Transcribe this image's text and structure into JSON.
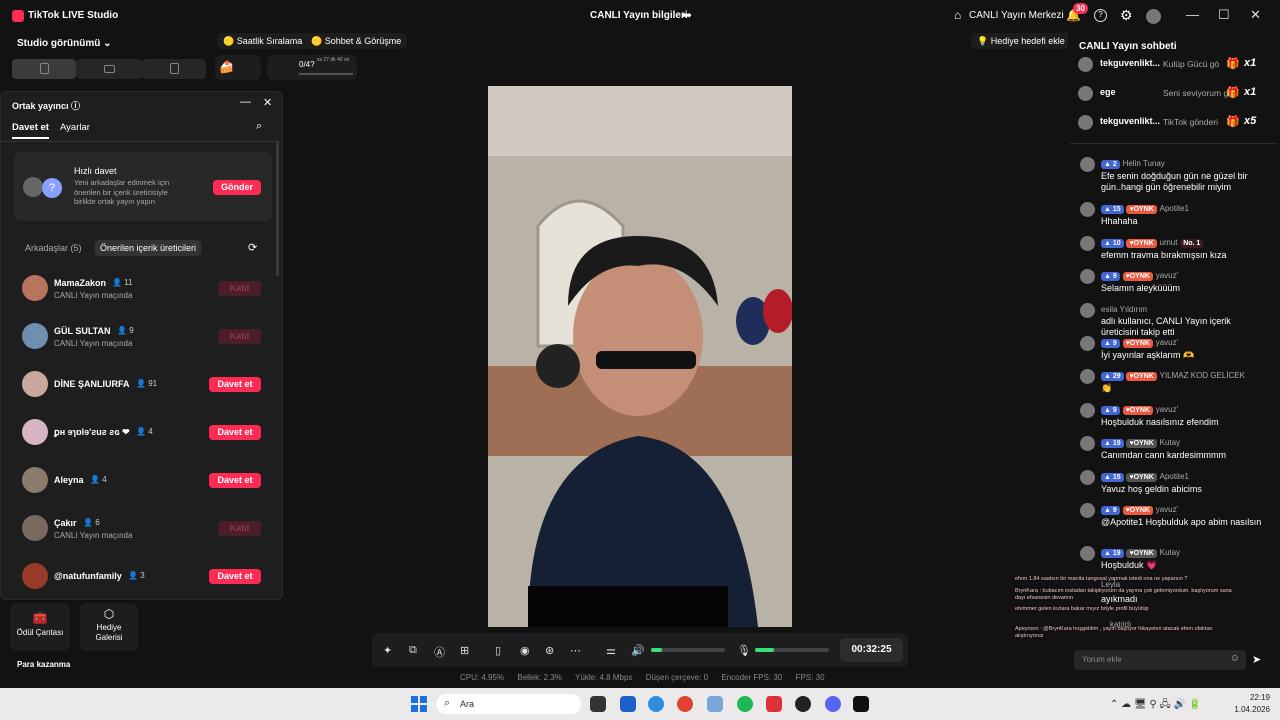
{
  "titlebar": {
    "app": "TikTok LIVE Studio",
    "center": "CANLI Yayın bilgileri",
    "home": "CANLI Yayın Merkezi",
    "badge": "30"
  },
  "studio": {
    "title": "Studio görünümü",
    "bottom": {
      "gift_bag": "Ödül Çantası",
      "gallery": "Hediye Galerisi",
      "earn": "Para kazanma"
    }
  },
  "topbar": {
    "hourly": "Saatlik Sıralama",
    "chat_match": "Sohbet & Görüşme",
    "gift_goal": "Hediye hedefi ekle",
    "progress": "0/4?",
    "timer": "ss 27 dk 40 sn"
  },
  "popup": {
    "title": "Ortak yayıncı",
    "tab_invite": "Davet et",
    "tab_settings": "Ayarlar",
    "quick": {
      "title": "Hızlı davet",
      "desc": "Yeni arkadaşlar edinmek için önerilen bir içerik üreticisiyle birlikte ortak yayın yapın",
      "button": "Gönder"
    },
    "friends": "Arkadaşlar (5)",
    "suggested": "Önerilen içerik üreticileri",
    "rows": [
      {
        "name": "MamaZakon",
        "count": "11",
        "sub": "CANLI Yayın maçında",
        "btn": "Katıl",
        "active": false,
        "color": "#b8745c"
      },
      {
        "name": "GÜL SULTAN",
        "count": "9",
        "sub": "CANLI Yayın maçında",
        "btn": "Katıl",
        "active": false,
        "color": "#6f8fb0"
      },
      {
        "name": "DİNE ŞANLIURFA",
        "count": "91",
        "sub": "",
        "btn": "Davet et",
        "active": true,
        "color": "#c9a89b"
      },
      {
        "name": "ꝑʜ ɘɿɒlɘ'ƨuƨ ƨɢ ❤",
        "count": "4",
        "sub": "",
        "btn": "Davet et",
        "active": true,
        "color": "#d9b4c4"
      },
      {
        "name": "Aleyna",
        "count": "4",
        "sub": "",
        "btn": "Davet et",
        "active": true,
        "color": "#8b7b6a"
      },
      {
        "name": "Çakır",
        "count": "6",
        "sub": "CANLI Yayın maçında",
        "btn": "Katıl",
        "active": false,
        "color": "#7a6a5e"
      },
      {
        "name": "@natufunfamily",
        "count": "3",
        "sub": "",
        "btn": "Davet et",
        "active": true,
        "color": "#9a3a2a"
      }
    ]
  },
  "chat": {
    "title": "CANLI Yayın sohbeti",
    "placeholder": "Yorum ekle",
    "gifts": [
      {
        "name": "tekguvenlikt...",
        "msg": "Kulüp Gücü gö",
        "mult": "x1"
      },
      {
        "name": "ege",
        "msg": "Seni seviyorum gönderildi",
        "mult": "x1"
      },
      {
        "name": "tekguvenlikt...",
        "msg": "TikTok gönderi",
        "mult": "x5"
      }
    ],
    "messages": [
      {
        "lvl": "2",
        "tag": "",
        "tag2": "",
        "user": "Helin Tunay",
        "msg": "Efe senin doğduğun gün ne güzel bir gün..hangi gün öğrenebilir miyim"
      },
      {
        "lvl": "15",
        "tag": "OYNK",
        "tag2": "",
        "user": "Apotite1",
        "msg": "Hhahaha"
      },
      {
        "lvl": "10",
        "tag": "OYNK",
        "tag2": "No. 1",
        "user": "umut",
        "msg": "efemm travma bırakmışsın kıza"
      },
      {
        "lvl": "9",
        "tag": "OYNK",
        "tag2": "",
        "user": "yavuz'",
        "msg": "Selamın aleyküüüm"
      },
      {
        "lvl": "",
        "tag": "",
        "tag2": "",
        "user": "esila Yıldırım",
        "msg": "adlı kullanıcı, CANLI Yayın içerik üreticisini takip etti"
      },
      {
        "lvl": "9",
        "tag": "OYNK",
        "tag2": "",
        "user": "yavuz'",
        "msg": "İyi yayınlar aşklarım 🫶"
      },
      {
        "lvl": "29",
        "tag": "OYNK",
        "tag2": "",
        "user": "YILMAZ KOD GELİCEK",
        "msg": "👏"
      },
      {
        "lvl": "9",
        "tag": "OYNK",
        "tag2": "",
        "user": "yavuz'",
        "msg": "Hoşbulduk nasılsınız efendim"
      },
      {
        "lvl": "19",
        "tag": "OYNK",
        "tag2": "",
        "user": "Kutay",
        "msg": "Canımdan cann kardesimmmm"
      },
      {
        "lvl": "15",
        "tag": "OYNK",
        "tag2": "",
        "user": "Apotite1",
        "msg": "Yavuz hoş geldin abicims"
      },
      {
        "lvl": "9",
        "tag": "OYNK",
        "tag2": "",
        "user": "yavuz'",
        "msg": "@Apotite1 Hoşbulduk apo abim nasılsın"
      },
      {
        "lvl": "19",
        "tag": "OYNK",
        "tag2": "",
        "user": "Kutay",
        "msg": "Hoşbulduk 💗"
      }
    ],
    "tail": {
      "user": "Leyla",
      "msg": "ayıkmadı",
      "joined": "katıldı"
    }
  },
  "overlay": {
    "lines": [
      "efem 1.84 saatsın bir manita tangosal yapmak istedi ona ne yaparsın ?",
      "BrynKara : bubacım instadan takipliyorum da yayına çok gelemiyordum. başlıyorum sana dayı efsanesin devamın",
      "efemmer gelen kızlara bakar mıyız böyle profil büyütüp",
      "Apeyronn : @BrynKara hoşgeldim , yayın başlıyor hikayeleri atacak efem ufaktan alıştırıyoruz"
    ]
  },
  "controls": {
    "time": "00:32:25",
    "audio_level": 0.15,
    "mic_level": 0.25
  },
  "stats": {
    "cpu": "CPU: 4.95%",
    "mem": "Bellek: 2.3%",
    "upload": "Yükle: 4.8 Mbps",
    "drop": "Düşen çerçeve: 0",
    "enc": "Encoder FPS: 30",
    "fps": "FPS: 30"
  },
  "taskbar": {
    "search": "Ara",
    "time": "22:19",
    "date": "1.04.2026"
  }
}
